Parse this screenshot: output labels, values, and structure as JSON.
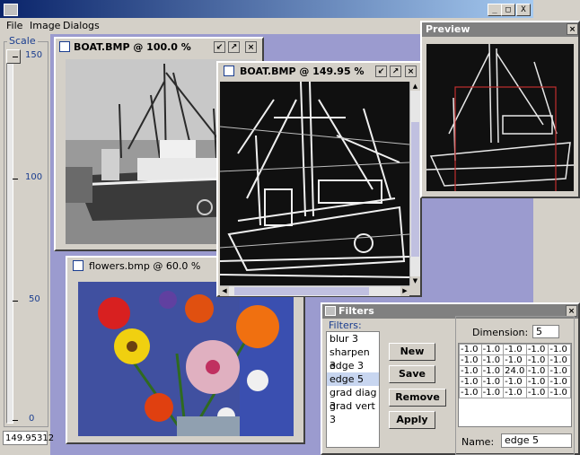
{
  "app": {
    "menus": [
      "File",
      "Image",
      "Dialogs"
    ]
  },
  "window_controls": {
    "minimize": "_",
    "maximize": "□",
    "close": "X"
  },
  "scale": {
    "title": "Scale",
    "ticks": [
      "150",
      "100",
      "50",
      "0"
    ],
    "value": "149.95312",
    "level_fraction": 0.9997
  },
  "frames": {
    "boat_orig": {
      "title": "BOAT.BMP  @ 100.0 %"
    },
    "boat_edge": {
      "title": "BOAT.BMP  @ 149.95 %"
    },
    "flowers": {
      "title": "flowers.bmp  @ 60.0 %"
    },
    "preview": {
      "title": "Preview"
    }
  },
  "filters": {
    "title": "Filters",
    "list_label": "Filters:",
    "items": [
      "blur 3",
      "sharpen 3",
      "edge 3",
      "edge 5",
      "grad diag 3",
      "grad vert 3"
    ],
    "selected": "edge 5",
    "buttons": {
      "new": "New",
      "save": "Save",
      "remove": "Remove",
      "apply": "Apply"
    },
    "dimension_label": "Dimension:",
    "dimension_value": "5",
    "kernel": [
      [
        "-1.0",
        "-1.0",
        "-1.0",
        "-1.0",
        "-1.0"
      ],
      [
        "-1.0",
        "-1.0",
        "-1.0",
        "-1.0",
        "-1.0"
      ],
      [
        "-1.0",
        "-1.0",
        "24.0",
        "-1.0",
        "-1.0"
      ],
      [
        "-1.0",
        "-1.0",
        "-1.0",
        "-1.0",
        "-1.0"
      ],
      [
        "-1.0",
        "-1.0",
        "-1.0",
        "-1.0",
        "-1.0"
      ]
    ],
    "name_label": "Name:",
    "name_value": "edge 5"
  },
  "colors": {
    "title_active": "#0a246a",
    "title_inactive": "#808080",
    "desktop": "#9b9bcf",
    "selection": "#c8d6f0"
  }
}
